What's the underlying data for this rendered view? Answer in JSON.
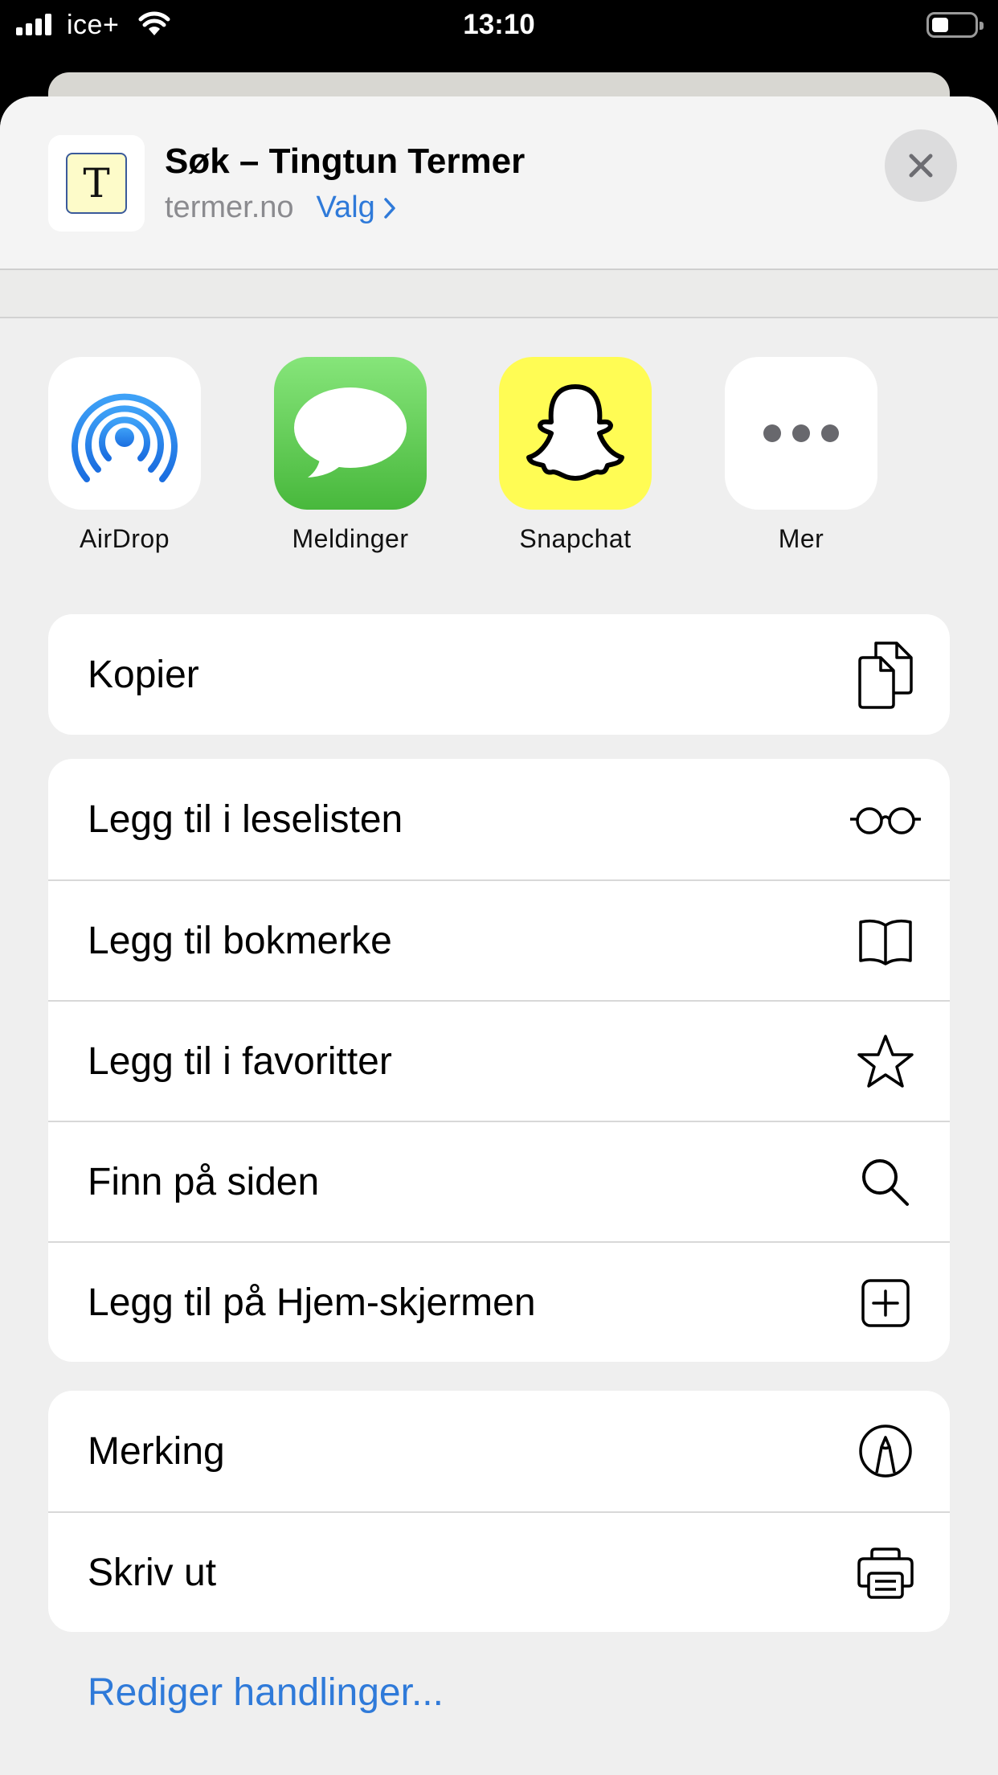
{
  "status_bar": {
    "carrier": "ice+",
    "time": "13:10"
  },
  "header": {
    "site_icon_letter": "T",
    "title": "Søk – Tingtun Termer",
    "domain": "termer.no",
    "options_label": "Valg"
  },
  "share_targets": [
    {
      "label": "AirDrop",
      "icon": "airdrop-icon"
    },
    {
      "label": "Meldinger",
      "icon": "messages-icon"
    },
    {
      "label": "Snapchat",
      "icon": "snapchat-icon"
    },
    {
      "label": "Mer",
      "icon": "more-icon"
    }
  ],
  "actions": {
    "group1": [
      {
        "label": "Kopier",
        "icon": "copy-icon"
      }
    ],
    "group2": [
      {
        "label": "Legg til i leselisten",
        "icon": "glasses-icon"
      },
      {
        "label": "Legg til bokmerke",
        "icon": "book-icon"
      },
      {
        "label": "Legg til i favoritter",
        "icon": "star-icon"
      },
      {
        "label": "Finn på siden",
        "icon": "search-icon"
      },
      {
        "label": "Legg til på Hjem-skjermen",
        "icon": "add-square-icon"
      }
    ],
    "group3": [
      {
        "label": "Merking",
        "icon": "markup-icon"
      },
      {
        "label": "Skriv ut",
        "icon": "printer-icon"
      }
    ]
  },
  "edit_actions_label": "Rediger handlinger...",
  "colors": {
    "accent": "#2f7ad9",
    "sheet_bg": "#efefef",
    "snapchat": "#fffc54"
  }
}
